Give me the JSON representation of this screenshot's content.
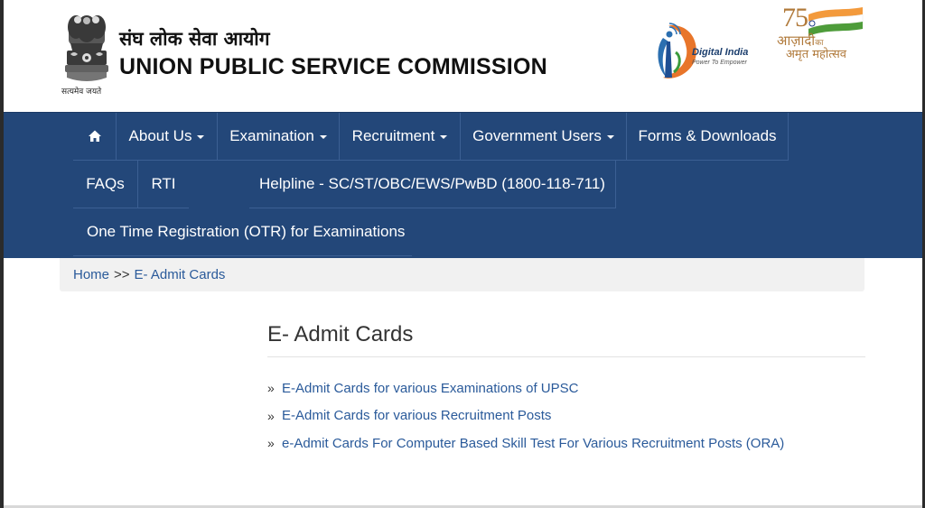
{
  "header": {
    "title_hindi": "संघ लोक सेवा आयोग",
    "title_english": "UNION PUBLIC SERVICE COMMISSION",
    "emblem_caption": "सत्यमेव जयते",
    "digital_india": {
      "name": "Digital India",
      "tagline": "Power To Empower"
    },
    "azadi": {
      "number": "75",
      "line1_main": "आज़ादी",
      "line1_small": "का",
      "line2": "अमृत महोत्सव"
    }
  },
  "nav": {
    "home_icon": "home-icon",
    "items": [
      {
        "label": "About Us",
        "dropdown": true
      },
      {
        "label": "Examination",
        "dropdown": true
      },
      {
        "label": "Recruitment",
        "dropdown": true
      },
      {
        "label": "Government Users",
        "dropdown": true
      },
      {
        "label": "Forms & Downloads",
        "dropdown": false
      },
      {
        "label": "FAQs",
        "dropdown": false
      },
      {
        "label": "RTI",
        "dropdown": false
      },
      {
        "label": "Helpline - SC/ST/OBC/EWS/PwBD (1800-118-711)",
        "dropdown": false
      },
      {
        "label": "One Time Registration (OTR) for Examinations",
        "dropdown": false
      }
    ]
  },
  "breadcrumb": {
    "home": "Home",
    "separator": ">>",
    "current": "E- Admit Cards"
  },
  "main": {
    "title": "E- Admit Cards",
    "bullet": "»",
    "links": [
      "E-Admit Cards for various Examinations of UPSC",
      "E-Admit Cards for various Recruitment Posts",
      "e-Admit Cards For Computer Based Skill Test For Various Recruitment Posts (ORA)"
    ]
  },
  "colors": {
    "nav_bg": "#234779",
    "link": "#2a5a9a",
    "breadcrumb_bg": "#f1f1f1"
  }
}
